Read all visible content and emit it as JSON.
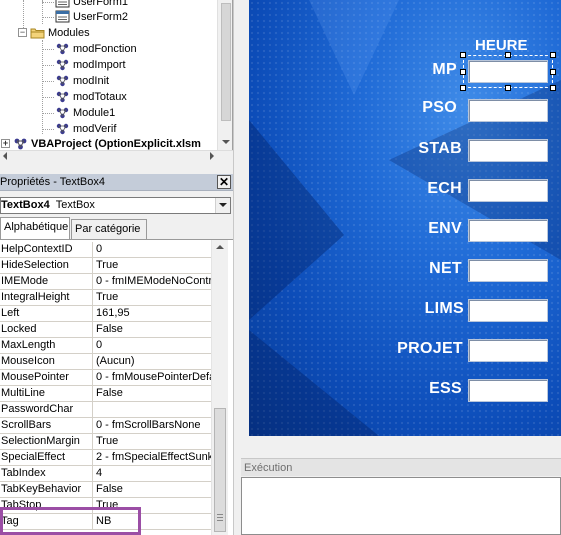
{
  "project_tree": {
    "items": [
      {
        "label": "UserForm1",
        "icon": "userform-icon",
        "level": 3,
        "expander": ""
      },
      {
        "label": "UserForm2",
        "icon": "userform-icon",
        "level": 3,
        "expander": ""
      },
      {
        "label": "Modules",
        "icon": "folder-icon",
        "level": 2,
        "expander": "−"
      },
      {
        "label": "modFonction",
        "icon": "module-icon",
        "level": 3,
        "expander": ""
      },
      {
        "label": "modImport",
        "icon": "module-icon",
        "level": 3,
        "expander": ""
      },
      {
        "label": "modInit",
        "icon": "module-icon",
        "level": 3,
        "expander": ""
      },
      {
        "label": "modTotaux",
        "icon": "module-icon",
        "level": 3,
        "expander": ""
      },
      {
        "label": "Module1",
        "icon": "module-icon",
        "level": 3,
        "expander": ""
      },
      {
        "label": "modVerif",
        "icon": "module-icon",
        "level": 3,
        "expander": ""
      },
      {
        "label": "VBAProject (OptionExplicit.xlsm",
        "icon": "vbaproject-icon",
        "level": 1,
        "expander": "+"
      }
    ]
  },
  "properties": {
    "title": "Propriétés - TextBox4",
    "close_label": "✕",
    "object_name": "TextBox4",
    "object_type": "TextBox",
    "tabs": [
      {
        "label": "Alphabétique",
        "active": true
      },
      {
        "label": "Par catégorie",
        "active": false
      }
    ],
    "rows": [
      {
        "name": "HelpContextID",
        "value": "0"
      },
      {
        "name": "HideSelection",
        "value": "True"
      },
      {
        "name": "IMEMode",
        "value": "0 - fmIMEModeNoControl"
      },
      {
        "name": "IntegralHeight",
        "value": "True"
      },
      {
        "name": "Left",
        "value": "161,95"
      },
      {
        "name": "Locked",
        "value": "False"
      },
      {
        "name": "MaxLength",
        "value": "0"
      },
      {
        "name": "MouseIcon",
        "value": "(Aucun)"
      },
      {
        "name": "MousePointer",
        "value": "0 - fmMousePointerDefault"
      },
      {
        "name": "MultiLine",
        "value": "False"
      },
      {
        "name": "PasswordChar",
        "value": ""
      },
      {
        "name": "ScrollBars",
        "value": "0 - fmScrollBarsNone"
      },
      {
        "name": "SelectionMargin",
        "value": "True"
      },
      {
        "name": "SpecialEffect",
        "value": "2 - fmSpecialEffectSunken"
      },
      {
        "name": "TabIndex",
        "value": "4"
      },
      {
        "name": "TabKeyBehavior",
        "value": "False"
      },
      {
        "name": "TabStop",
        "value": "True"
      },
      {
        "name": "Tag",
        "value": "NB"
      }
    ]
  },
  "userform": {
    "header_label": "HEURE",
    "fields": [
      {
        "label": "MP",
        "value": "",
        "selected": true
      },
      {
        "label": "PSO",
        "value": "",
        "selected": false
      },
      {
        "label": "STAB",
        "value": "",
        "selected": false
      },
      {
        "label": "ECH",
        "value": "",
        "selected": false
      },
      {
        "label": "ENV",
        "value": "",
        "selected": false
      },
      {
        "label": "NET",
        "value": "",
        "selected": false
      },
      {
        "label": "LIMS",
        "value": "",
        "selected": false
      },
      {
        "label": "PROJET",
        "value": "",
        "selected": false
      },
      {
        "label": "ESS",
        "value": "",
        "selected": false
      }
    ]
  },
  "immediate_window": {
    "title": "Exécution",
    "content": ""
  },
  "colors": {
    "form_blue": "#1f6ad6",
    "highlight_purple": "#9b4ea5",
    "title_bar": "#c4ccd9"
  }
}
